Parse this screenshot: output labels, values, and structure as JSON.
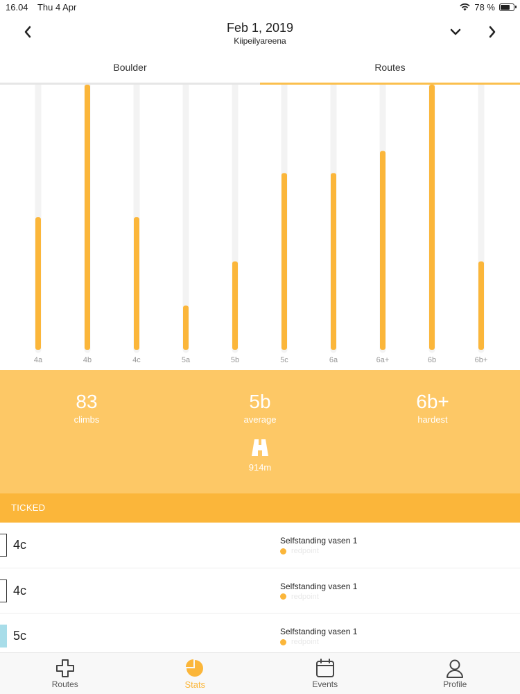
{
  "status_bar": {
    "time": "16.04",
    "date": "Thu 4 Apr",
    "battery": "78 %",
    "battery_level": 0.78
  },
  "header": {
    "title": "Feb 1, 2019",
    "subtitle": "Kiipeilyareena"
  },
  "tabs": [
    {
      "label": "Boulder"
    },
    {
      "label": "Routes"
    }
  ],
  "active_tab": "Routes",
  "chart_data": {
    "type": "bar",
    "categories": [
      "4a",
      "4b",
      "4c",
      "5a",
      "5b",
      "5c",
      "6a",
      "6a+",
      "6b",
      "6b+"
    ],
    "values": [
      6,
      12,
      6,
      2,
      4,
      8,
      8,
      9,
      12,
      4
    ],
    "ylim": [
      0,
      12
    ],
    "grid": false,
    "bar_color": "#fbb63a",
    "track_color": "#f3f3f3"
  },
  "summary": {
    "climbs_value": "83",
    "climbs_label": "climbs",
    "average_value": "5b",
    "average_label": "average",
    "hardest_value": "6b+",
    "hardest_label": "hardest",
    "distance": "914m",
    "distance_icon": "road-icon"
  },
  "ticked_header": "TICKED",
  "ticked": [
    {
      "grade": "4c",
      "name": "Selfstanding vasen 1",
      "status": "redpoint",
      "color": "#ffffff"
    },
    {
      "grade": "4c",
      "name": "Selfstanding vasen 1",
      "status": "redpoint",
      "color": "#ffffff"
    },
    {
      "grade": "5c",
      "name": "Selfstanding vasen 1",
      "status": "redpoint",
      "color": "#a8dde9"
    }
  ],
  "tabbar": [
    {
      "label": "Routes",
      "icon": "plus-icon"
    },
    {
      "label": "Stats",
      "icon": "pie-chart-icon"
    },
    {
      "label": "Events",
      "icon": "calendar-icon"
    },
    {
      "label": "Profile",
      "icon": "person-icon"
    }
  ],
  "colors": {
    "accent": "#fbb63a",
    "summary_bg": "#fdc866"
  }
}
